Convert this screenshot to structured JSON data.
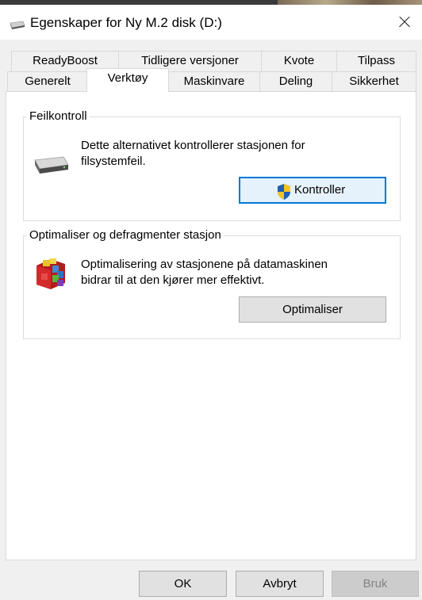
{
  "window": {
    "title": "Egenskaper for Ny M.2 disk (D:)",
    "drive_icon": "drive-icon",
    "close_icon": "close-icon"
  },
  "tabs": {
    "row1": [
      "ReadyBoost",
      "Tidligere versjoner",
      "Kvote",
      "Tilpass"
    ],
    "row2": [
      "Generelt",
      "Verktøy",
      "Maskinvare",
      "Deling",
      "Sikkerhet"
    ],
    "active": "Verktøy"
  },
  "error_check": {
    "group_label": "Feilkontroll",
    "description_line1": "Dette alternativet kontrollerer stasjonen for",
    "description_line2": "filsystemfeil.",
    "button_label": "Kontroller",
    "button_icon": "uac-shield-icon"
  },
  "optimize": {
    "group_label": "Optimaliser og defragmenter stasjon",
    "description_line1": "Optimalisering av stasjonene på datamaskinen",
    "description_line2": "bidrar til at den kjører mer effektivt.",
    "button_label": "Optimaliser",
    "icon": "defrag-icon"
  },
  "footer": {
    "ok_label": "OK",
    "cancel_label": "Avbryt",
    "apply_label": "Bruk"
  },
  "colors": {
    "focus_border": "#0078d7",
    "window_bg": "#f0f0f0",
    "panel_bg": "#ffffff"
  }
}
